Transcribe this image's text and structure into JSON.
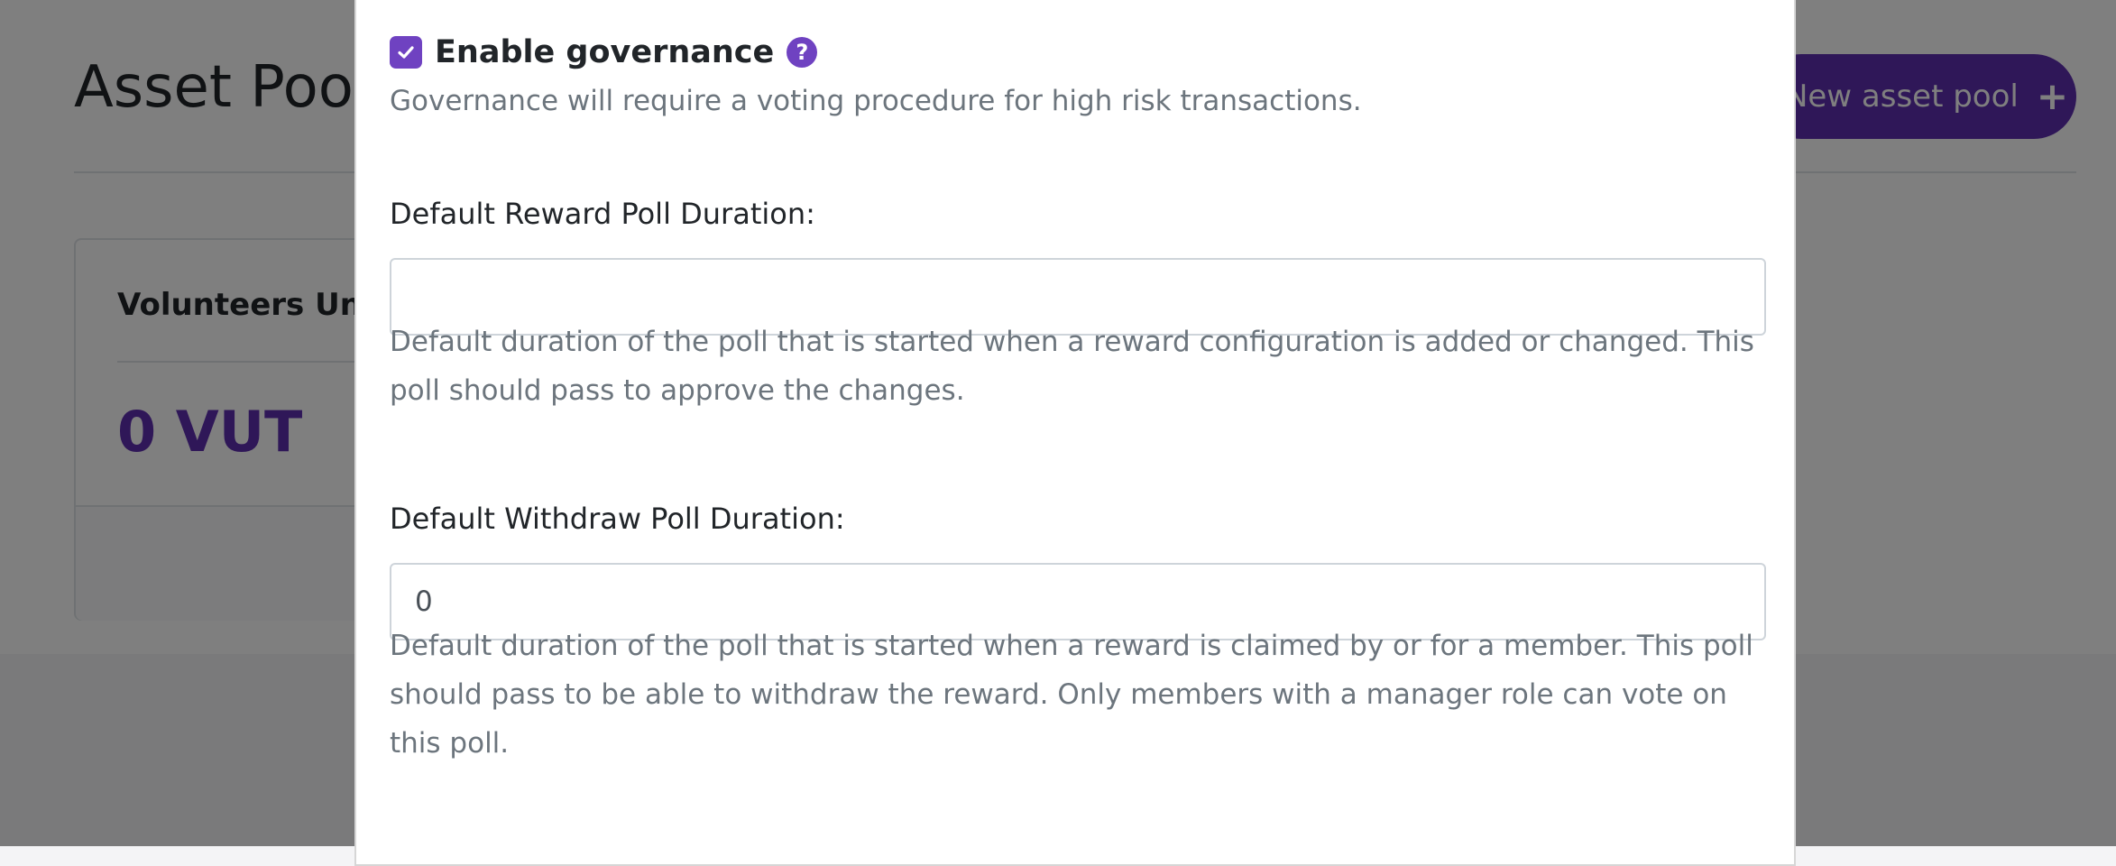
{
  "background": {
    "page_title": "Asset Pools",
    "new_pool_button": "New asset pool",
    "pool_card": {
      "name": "Volunteers United",
      "balance": "0 VUT"
    }
  },
  "modal": {
    "governance": {
      "checked": true,
      "label": "Enable governance",
      "help": "Governance will require a voting procedure for high risk transactions."
    },
    "reward_poll": {
      "label": "Default Reward Poll Duration:",
      "value": "",
      "help": "Default duration of the poll that is started when a reward configuration is added or changed. This poll should pass to approve the changes."
    },
    "withdraw_poll": {
      "label": "Default Withdraw Poll Duration:",
      "value": "0",
      "help": "Default duration of the poll that is started when a reward is claimed by or for a member. This poll should pass to be able to withdraw the reward. Only members with a manager role can vote on this poll."
    }
  },
  "colors": {
    "accent": "#6f42c1",
    "brand_button": "#5f2eb0",
    "help_text": "#6c757d"
  }
}
